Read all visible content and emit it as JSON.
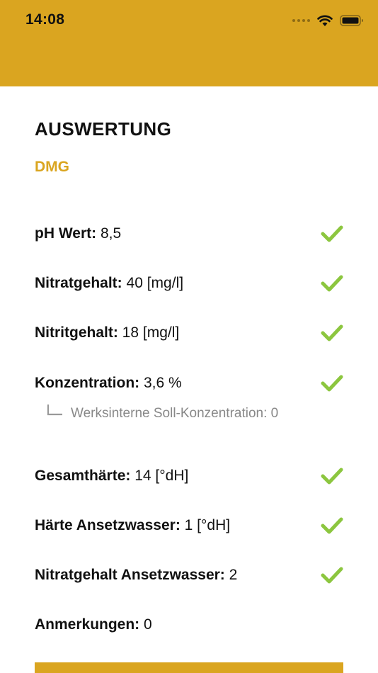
{
  "status_bar": {
    "time": "14:08"
  },
  "title": "AUSWERTUNG",
  "subtitle": "DMG",
  "rows": [
    {
      "label": "pH Wert:",
      "value": "8,5"
    },
    {
      "label": "Nitratgehalt:",
      "value": "40 [mg/l]"
    },
    {
      "label": "Nitritgehalt:",
      "value": "18 [mg/l]"
    },
    {
      "label": "Konzentration:",
      "value": "3,6 %"
    },
    {
      "label": "Gesamthärte:",
      "value": "14 [°dH]"
    },
    {
      "label": "Härte Ansetzwasser:",
      "value": "1 [°dH]"
    },
    {
      "label": "Nitratgehalt Ansetzwasser:",
      "value": "2"
    },
    {
      "label": "Anmerkungen:",
      "value": "0"
    }
  ],
  "sub_info": "Werksinterne Soll-Konzentration: 0",
  "colors": {
    "accent": "#DAA520",
    "check": "#8CC63F",
    "muted": "#888888"
  },
  "icons": {
    "check": "checkmark-icon",
    "wifi": "wifi-icon",
    "battery": "battery-icon",
    "signal": "signal-icon",
    "sub_connector": "tree-connector-icon"
  }
}
